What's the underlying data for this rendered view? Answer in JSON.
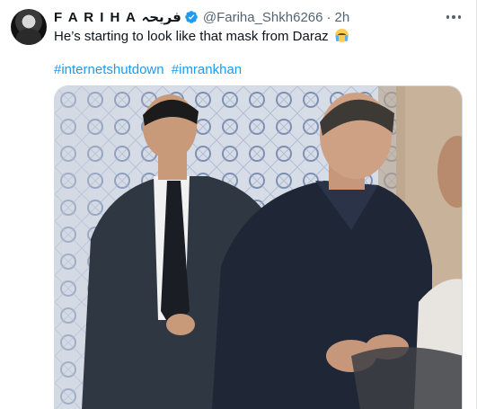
{
  "tweet": {
    "author_name": "F A R I H A فریحہ",
    "author_handle": "@Fariha_Shkh6266",
    "separator": "·",
    "time": "2h",
    "text": "He’s starting to look like that mask from Daraz",
    "emoji": "loudly-crying-face-emoji",
    "hashtags": [
      "#internetshutdown",
      "#imrankhan"
    ],
    "verified_icon": "verified-badge-icon",
    "more_icon": "more-options-icon"
  },
  "colors": {
    "link": "#1d9bf0",
    "secondary_text": "#536471",
    "primary_text": "#0f1419",
    "verified": "#1d9bf0"
  }
}
